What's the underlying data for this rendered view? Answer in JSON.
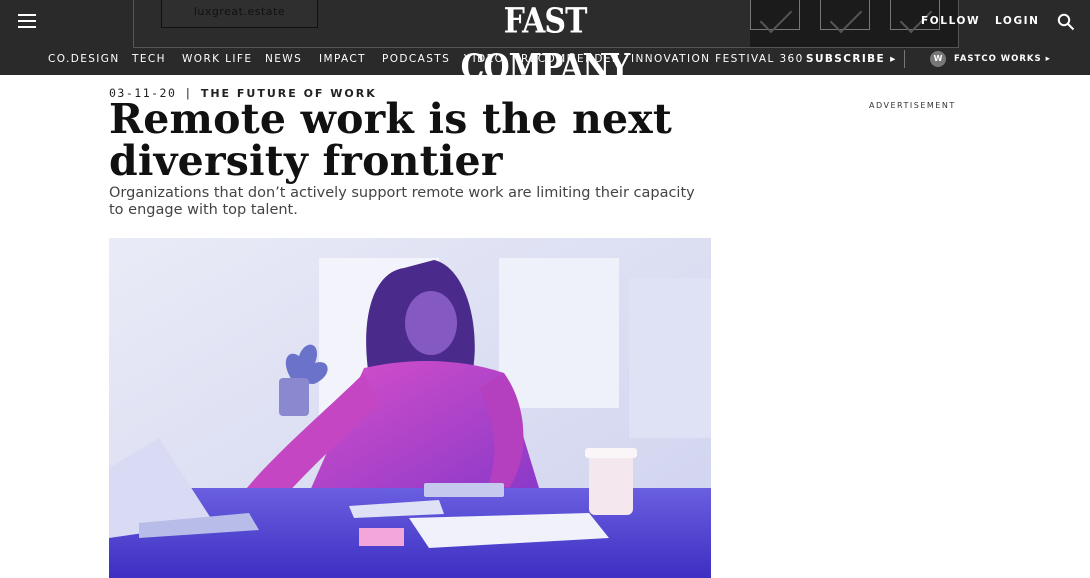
{
  "header": {
    "menu_icon": "hamburger-icon",
    "logo": "FAST COMPANY",
    "follow": "FOLLOW",
    "login": "LOGIN",
    "search_icon": "search-icon",
    "ad_banner_text": "luxgreat.estate"
  },
  "nav": {
    "items": [
      "CO.DESIGN",
      "TECH",
      "WORK LIFE",
      "NEWS",
      "IMPACT",
      "PODCASTS",
      "VIDEO",
      "RECOMMENDER",
      "INNOVATION FESTIVAL 360"
    ],
    "subscribe": "SUBSCRIBE ▸",
    "badge": "W",
    "fastco_works": "FASTCO WORKS ▸"
  },
  "article": {
    "date": "03-11-20",
    "separator": "|",
    "section": "THE FUTURE OF WORK",
    "headline": "Remote work is the next diversity frontier",
    "dek": "Organizations that don’t actively support remote work are limiting their capacity to engage with top talent."
  },
  "sidebar": {
    "ad_label": "ADVERTISEMENT"
  },
  "colors": {
    "topbar": "#2a2a2a",
    "hero_purple": "#5b4fd8",
    "hero_magenta": "#c236b8"
  }
}
